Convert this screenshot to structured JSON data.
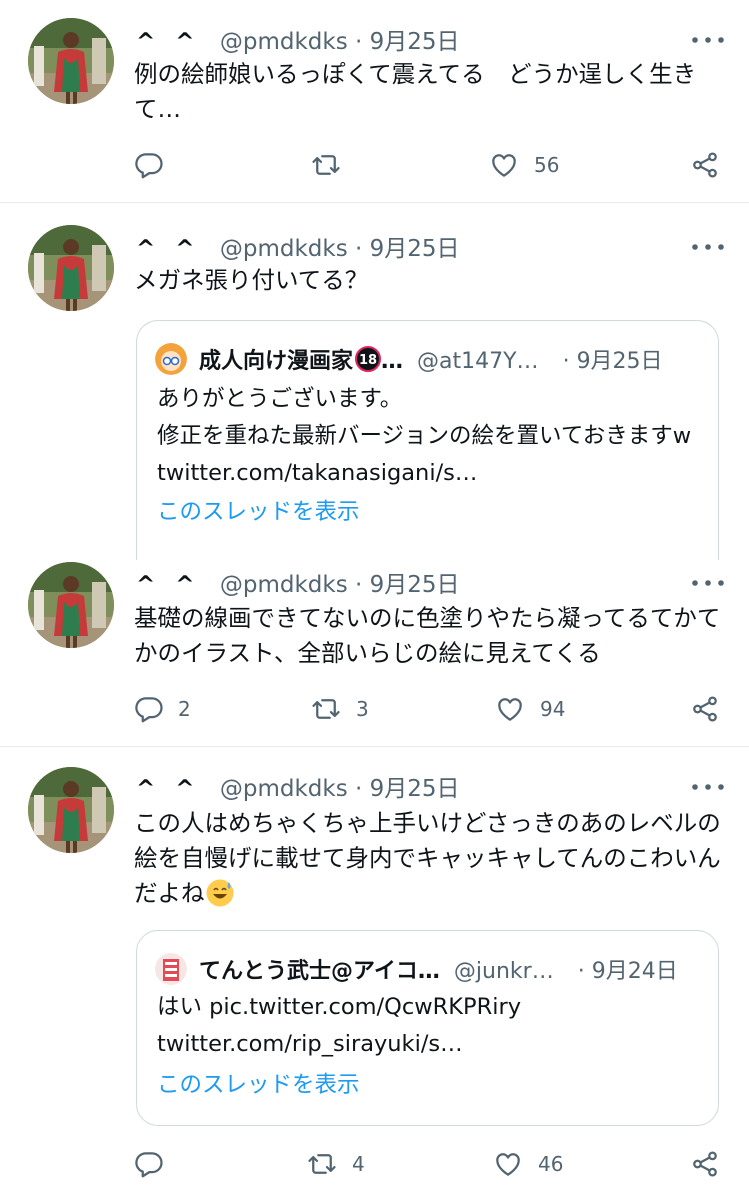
{
  "tweets": [
    {
      "display_name": "^ ^",
      "handle": "@pmdkdks",
      "dot": "·",
      "date": "9月25日",
      "text": "例の絵師娘いるっぽくて震えてる　どうか逞しく生きて…",
      "reply_count": "",
      "retweet_count": "",
      "like_count": "56"
    },
    {
      "display_name": "^ ^",
      "handle": "@pmdkdks",
      "dot": "·",
      "date": "9月25日",
      "text": "メガネ張り付いてる？",
      "quote": {
        "name": "成人向け漫画家",
        "badge": "18",
        "ellipsis": "…",
        "handle": "@at147Y…",
        "dot": "·",
        "date": "9月25日",
        "text": "ありがとうございます。\n修正を重ねた最新バージョンの絵を置いておきますw  twitter.com/takanasigani/s…",
        "thread_link": "このスレッドを表示"
      }
    },
    {
      "display_name": "^ ^",
      "handle": "@pmdkdks",
      "dot": "·",
      "date": "9月25日",
      "text": "基礎の線画できてないのに色塗りやたら凝ってるてかてかのイラスト、全部いらじの絵に見えてくる",
      "reply_count": "2",
      "retweet_count": "3",
      "like_count": "94"
    },
    {
      "display_name": "^ ^",
      "handle": "@pmdkdks",
      "dot": "·",
      "date": "9月25日",
      "text": "この人はめちゃくちゃ上手いけどさっきのあのレベルの絵を自慢げに載せて身内でキャッキャしてんのこわいんだよね",
      "emoji": "sweat-smile-emoji",
      "quote": {
        "name": "てんとう武士@アイコ…",
        "handle": "@junkr…",
        "dot": "·",
        "date": "9月24日",
        "text": "はい pic.twitter.com/QcwRKPRiry\ntwitter.com/rip_sirayuki/s…",
        "thread_link": "このスレッドを表示"
      },
      "reply_count": "",
      "retweet_count": "4",
      "like_count": "46"
    }
  ],
  "colors": {
    "text": "#0f1419",
    "muted": "#536471",
    "link": "#1d9bf0",
    "border": "#cfd9de"
  },
  "icons": [
    "reply-icon",
    "retweet-icon",
    "like-icon",
    "share-icon",
    "more-icon"
  ]
}
